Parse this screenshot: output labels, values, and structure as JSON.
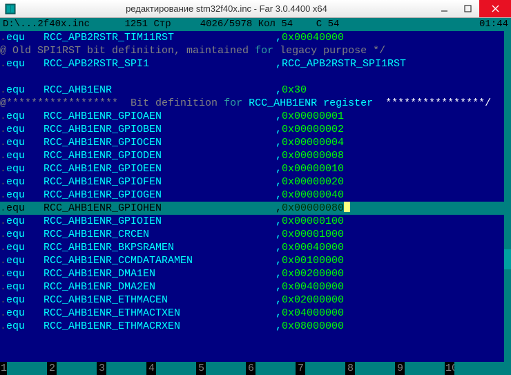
{
  "window": {
    "title": "редактирование stm32f40x.inc - Far 3.0.4400 x64"
  },
  "status": {
    "path": "D:\\...2f40x.inc",
    "codepage": "1251",
    "mode": "Стр",
    "line_total": "4026/5978",
    "col_label": "Кол",
    "col": "54",
    "char_label": "С",
    "char": "54",
    "time": "01:44"
  },
  "lines": [
    {
      "t": "equ",
      "id": "RCC_APB2RSTR_TIM11RST",
      "val": "0x00040000"
    },
    {
      "t": "cmt_old",
      "text": "@ Old SPI1RST bit definition, maintained ",
      "for": "for",
      "rest": " legacy purpose */"
    },
    {
      "t": "equ",
      "id": "RCC_APB2RSTR_SPI1",
      "val": "RCC_APB2RSTR_SPI1RST",
      "id_ref": true
    },
    {
      "t": "blank"
    },
    {
      "t": "equ",
      "id": "RCC_AHB1ENR",
      "val": "0x30"
    },
    {
      "t": "banner",
      "pre": "@******************",
      "mid": "  Bit definition ",
      "for": "for",
      "name": " RCC_AHB1ENR register  ",
      "post": "****************/"
    },
    {
      "t": "equ",
      "id": "RCC_AHB1ENR_GPIOAEN",
      "val": "0x00000001"
    },
    {
      "t": "equ",
      "id": "RCC_AHB1ENR_GPIOBEN",
      "val": "0x00000002"
    },
    {
      "t": "equ",
      "id": "RCC_AHB1ENR_GPIOCEN",
      "val": "0x00000004"
    },
    {
      "t": "equ",
      "id": "RCC_AHB1ENR_GPIODEN",
      "val": "0x00000008"
    },
    {
      "t": "equ",
      "id": "RCC_AHB1ENR_GPIOEEN",
      "val": "0x00000010"
    },
    {
      "t": "equ",
      "id": "RCC_AHB1ENR_GPIOFEN",
      "val": "0x00000020"
    },
    {
      "t": "equ",
      "id": "RCC_AHB1ENR_GPIOGEN",
      "val": "0x00000040"
    },
    {
      "t": "equ",
      "id": "RCC_AHB1ENR_GPIOHEN",
      "val": "0x00000080",
      "cursor": true
    },
    {
      "t": "equ",
      "id": "RCC_AHB1ENR_GPIOIEN",
      "val": "0x00000100"
    },
    {
      "t": "equ",
      "id": "RCC_AHB1ENR_CRCEN",
      "val": "0x00001000"
    },
    {
      "t": "equ",
      "id": "RCC_AHB1ENR_BKPSRAMEN",
      "val": "0x00040000"
    },
    {
      "t": "equ",
      "id": "RCC_AHB1ENR_CCMDATARAMEN",
      "val": "0x00100000"
    },
    {
      "t": "equ",
      "id": "RCC_AHB1ENR_DMA1EN",
      "val": "0x00200000"
    },
    {
      "t": "equ",
      "id": "RCC_AHB1ENR_DMA2EN",
      "val": "0x00400000"
    },
    {
      "t": "equ",
      "id": "RCC_AHB1ENR_ETHMACEN",
      "val": "0x02000000"
    },
    {
      "t": "equ",
      "id": "RCC_AHB1ENR_ETHMACTXEN",
      "val": "0x04000000"
    },
    {
      "t": "equ",
      "id": "RCC_AHB1ENR_ETHMACRXEN",
      "val": "0x08000000"
    }
  ],
  "keybar": [
    "1",
    "2",
    "3",
    "4",
    "5",
    "6",
    "7",
    "8",
    "9",
    "10"
  ],
  "keylabels": [
    "",
    "",
    "",
    "",
    "",
    "",
    "",
    "",
    "",
    ""
  ]
}
